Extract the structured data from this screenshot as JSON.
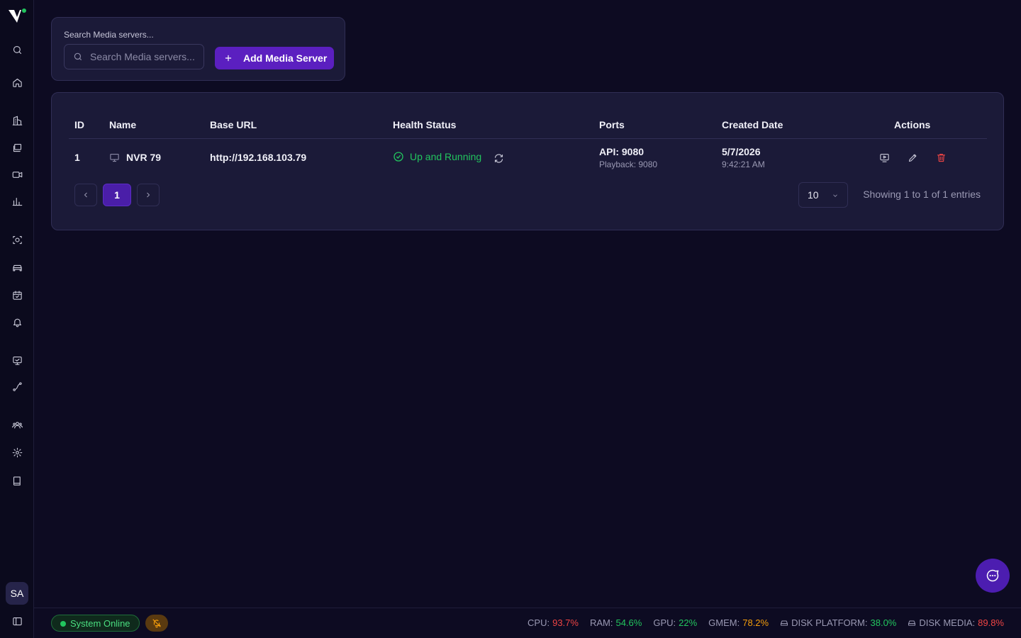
{
  "search": {
    "label": "Search Media servers...",
    "placeholder": "Search Media servers..."
  },
  "toolbar": {
    "add_label": "Add Media Server"
  },
  "table": {
    "columns": [
      "ID",
      "Name",
      "Base URL",
      "Health Status",
      "Ports",
      "Created Date",
      "Actions"
    ],
    "rows": [
      {
        "id": "1",
        "name": "NVR 79",
        "base_url": "http://192.168.103.79",
        "health": "Up and Running",
        "api_port": "API: 9080",
        "playback_port": "Playback: 9080",
        "created_date": "5/7/2026",
        "created_time": "9:42:21 AM"
      }
    ]
  },
  "pagination": {
    "current_page": "1",
    "page_size": "10",
    "showing": "Showing 1 to 1 of 1 entries"
  },
  "user": {
    "initials": "SA"
  },
  "footer": {
    "status": "System Online",
    "cpu_label": "CPU:",
    "cpu_value": "93.7%",
    "ram_label": "RAM:",
    "ram_value": "54.6%",
    "gpu_label": "GPU:",
    "gpu_value": "22%",
    "gmem_label": "GMEM:",
    "gmem_value": "78.2%",
    "disk_platform_label": "DISK PLATFORM:",
    "disk_platform_value": "38.0%",
    "disk_media_label": "DISK MEDIA:",
    "disk_media_value": "89.8%"
  },
  "icons": {
    "sidebar": [
      "search-icon",
      "home-icon",
      "building-icon",
      "layers-icon",
      "video-camera-icon",
      "bar-chart-icon",
      "face-scan-icon",
      "car-icon",
      "calendar-check-icon",
      "bell-icon",
      "monitor-icon",
      "route-icon",
      "users-icon",
      "gear-icon",
      "book-icon",
      "sidebar-toggle-icon"
    ]
  },
  "colors": {
    "accent": "#5b1fc0",
    "healthy": "#22c55e",
    "danger": "#ef4444",
    "warning": "#f59e0b"
  }
}
